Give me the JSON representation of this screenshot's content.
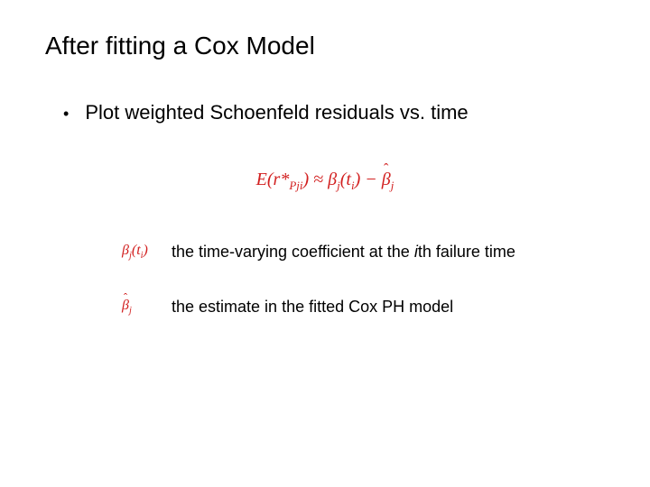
{
  "title": "After fitting a Cox Model",
  "bullet": "Plot weighted Schoenfeld residuals vs. time",
  "definitions": {
    "timevar_prefix": "the time-varying coefficient at the ",
    "timevar_i": "i",
    "timevar_suffix": "th failure time",
    "estimate": "the estimate in the fitted Cox PH model"
  }
}
